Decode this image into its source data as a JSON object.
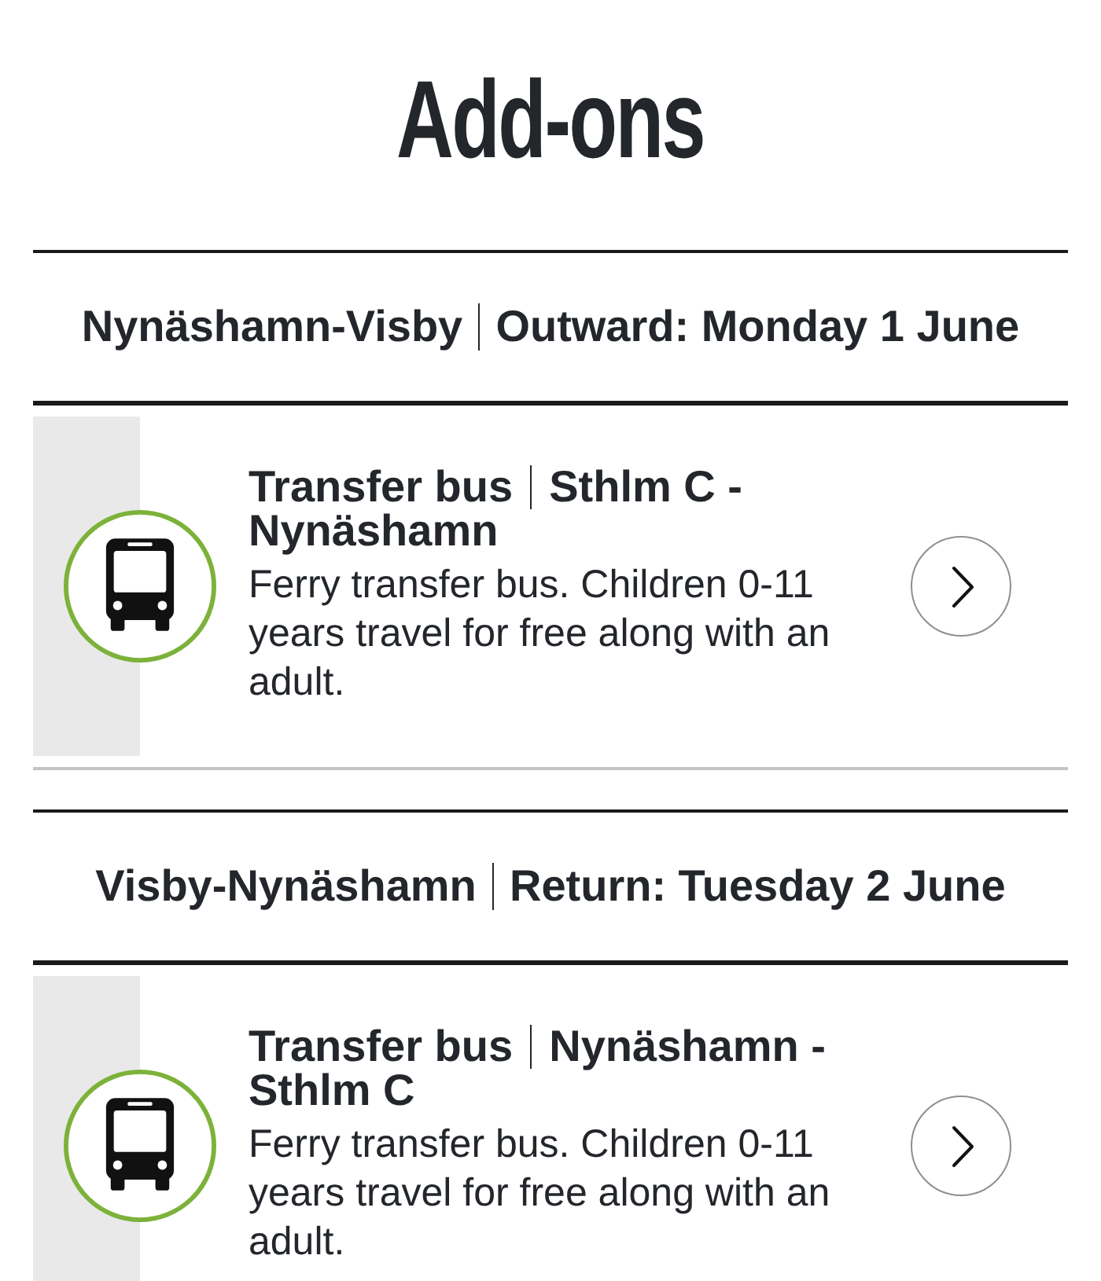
{
  "page": {
    "title": "Add-ons"
  },
  "sections": [
    {
      "route": "Nynäshamn-Visby",
      "trip": "Outward: Monday 1 June",
      "addons": [
        {
          "product": "Transfer bus",
          "route": "Sthlm C - Nynäshamn",
          "description": "Ferry transfer bus. Children 0-11 years travel for free along with an adult."
        }
      ]
    },
    {
      "route": "Visby-Nynäshamn",
      "trip": "Return: Tuesday 2 June",
      "addons": [
        {
          "product": "Transfer bus",
          "route": "Nynäshamn - Sthlm C",
          "description": "Ferry transfer bus. Children 0-11 years travel for free along with an adult."
        }
      ]
    }
  ]
}
